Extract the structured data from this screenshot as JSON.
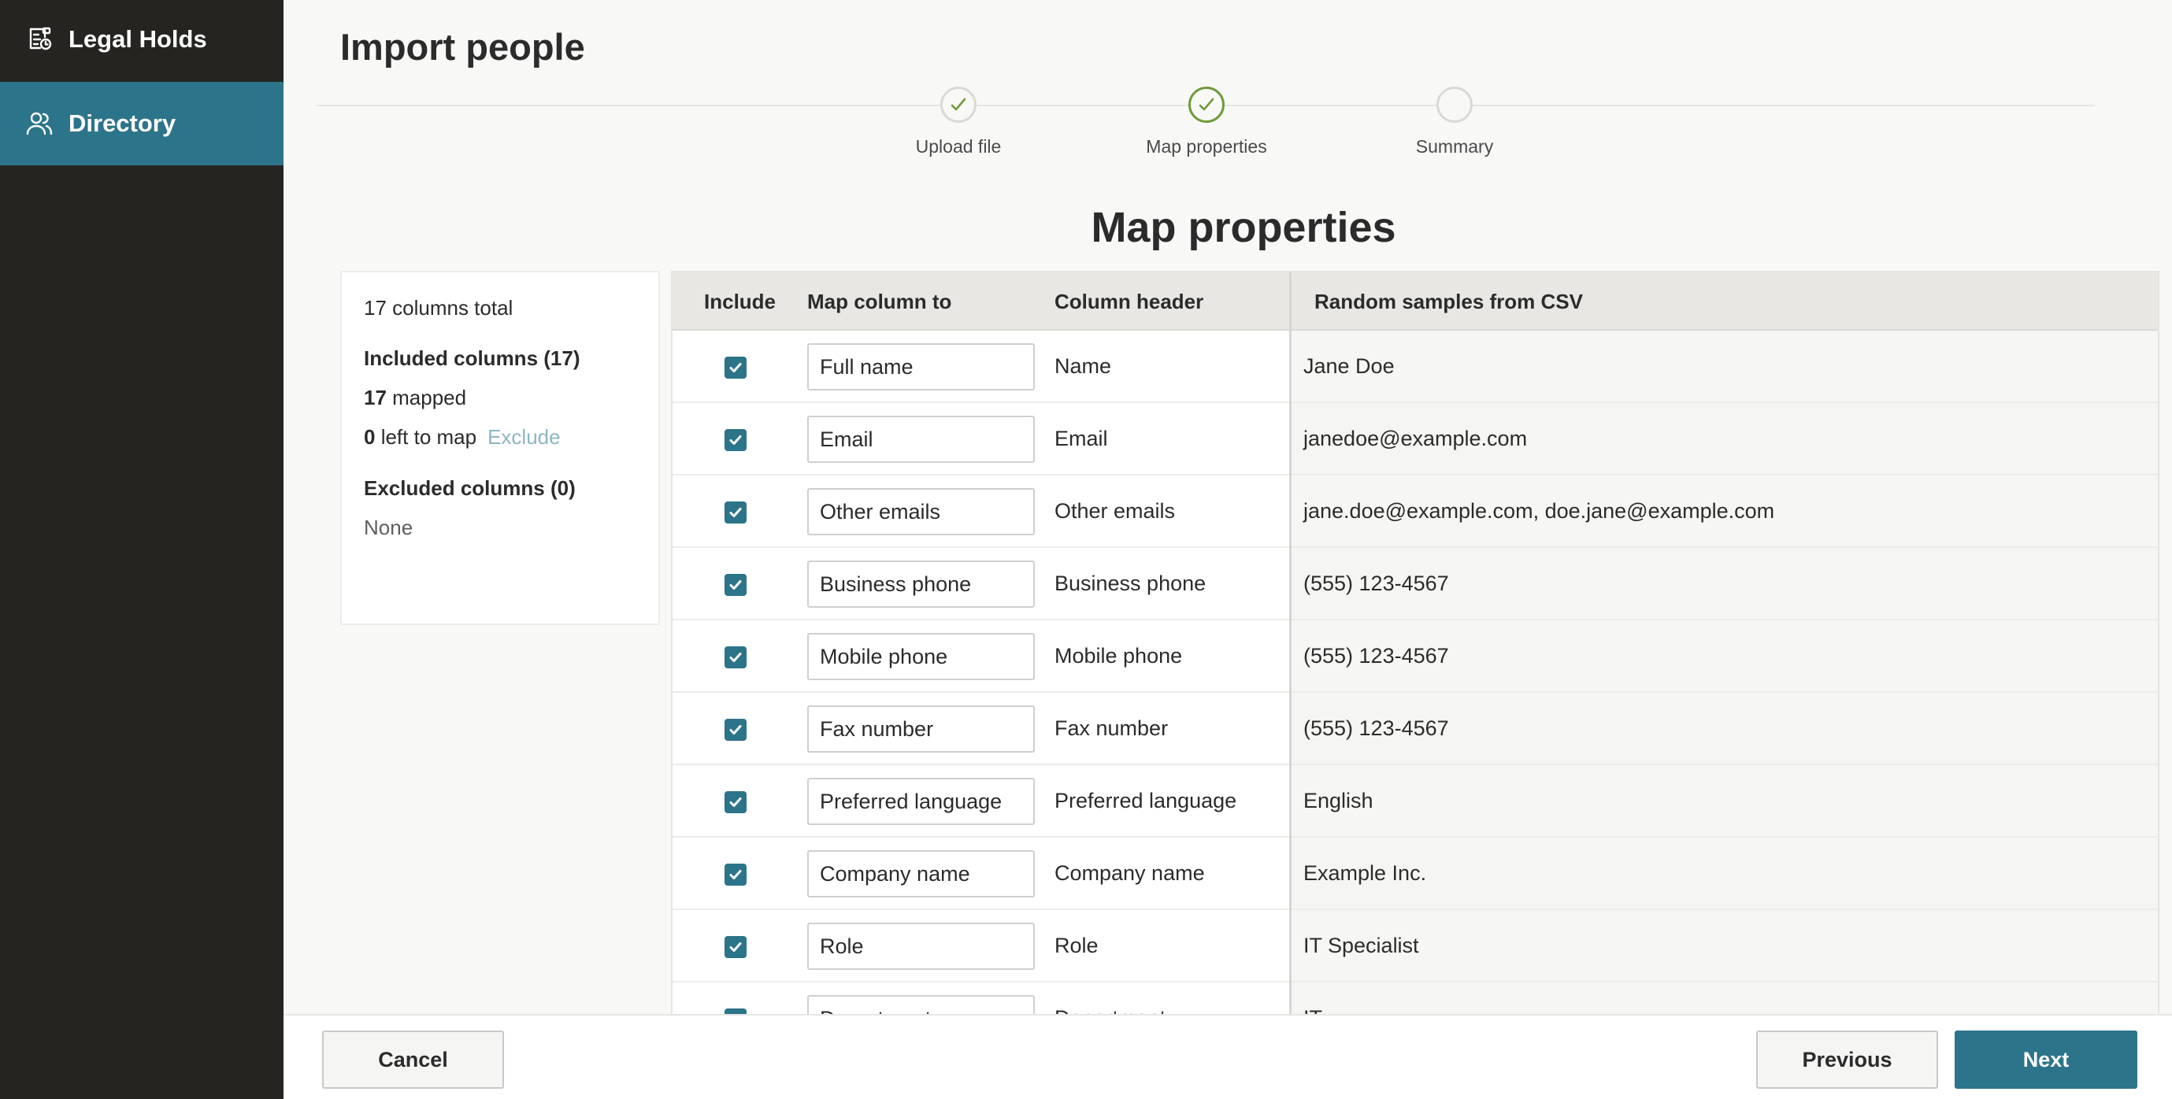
{
  "sidebar": {
    "items": [
      {
        "label": "Legal Holds",
        "icon": "legal-holds-icon",
        "active": false
      },
      {
        "label": "Directory",
        "icon": "people-icon",
        "active": true
      }
    ],
    "active_color": "#2c7489"
  },
  "page": {
    "title": "Import people",
    "section_title": "Map properties"
  },
  "stepper": {
    "steps": [
      {
        "label": "Upload file",
        "state": "complete"
      },
      {
        "label": "Map properties",
        "state": "current"
      },
      {
        "label": "Summary",
        "state": "pending"
      }
    ],
    "complete_color": "#6e9b3a"
  },
  "summary": {
    "total": "17 columns total",
    "included_heading": "Included columns (17)",
    "mapped_count": "17",
    "mapped_label": " mapped",
    "left_count": "0",
    "left_label": " left to map",
    "exclude_link": "Exclude",
    "excluded_heading": "Excluded columns (0)",
    "excluded_value": "None"
  },
  "table": {
    "headers": {
      "include": "Include",
      "map_to": "Map column to",
      "column_header": "Column header",
      "samples": "Random samples from CSV"
    },
    "rows": [
      {
        "included": true,
        "map_to": "Full name",
        "column_header": "Name",
        "sample": "Jane Doe"
      },
      {
        "included": true,
        "map_to": "Email",
        "column_header": "Email",
        "sample": "janedoe@example.com"
      },
      {
        "included": true,
        "map_to": "Other emails",
        "column_header": "Other emails",
        "sample": "jane.doe@example.com, doe.jane@example.com"
      },
      {
        "included": true,
        "map_to": "Business phone",
        "column_header": "Business phone",
        "sample": "(555) 123-4567"
      },
      {
        "included": true,
        "map_to": "Mobile phone",
        "column_header": "Mobile phone",
        "sample": "(555) 123-4567"
      },
      {
        "included": true,
        "map_to": "Fax number",
        "column_header": "Fax number",
        "sample": "(555) 123-4567"
      },
      {
        "included": true,
        "map_to": "Preferred language",
        "column_header": "Preferred language",
        "sample": "English"
      },
      {
        "included": true,
        "map_to": "Company name",
        "column_header": "Company name",
        "sample": "Example Inc."
      },
      {
        "included": true,
        "map_to": "Role",
        "column_header": "Role",
        "sample": "IT Specialist"
      },
      {
        "included": true,
        "map_to": "Department",
        "column_header": "Department",
        "sample": "IT"
      }
    ]
  },
  "footer": {
    "cancel": "Cancel",
    "previous": "Previous",
    "next": "Next"
  },
  "accent_color": "#2c7489"
}
